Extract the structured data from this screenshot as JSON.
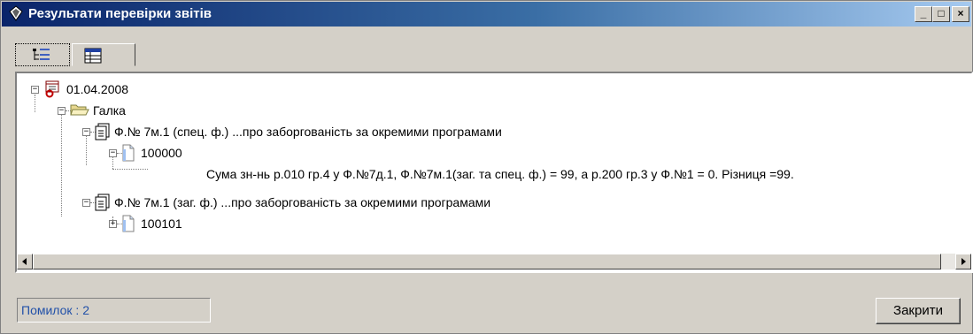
{
  "window": {
    "title": "Результати перевірки звітів",
    "controls": {
      "minimize": "_",
      "maximize": "□",
      "close": "×"
    }
  },
  "tabs": [
    {
      "name": "tree-view",
      "icon": "tree-list-icon"
    },
    {
      "name": "table-view",
      "icon": "table-grid-icon"
    }
  ],
  "tree": {
    "nodes": [
      {
        "label": "01.04.2008",
        "icon": "calendar-error-icon",
        "expanded": true
      },
      {
        "label": "Галка",
        "icon": "folder-open-icon",
        "expanded": true
      },
      {
        "label": "Ф.№ 7м.1 (спец. ф.) ...про заборгованість за окремими програмами",
        "icon": "document-icon",
        "expanded": true
      },
      {
        "label": "100000",
        "icon": "page-icon",
        "expanded": true
      },
      {
        "label": "Сума зн-нь р.010 гр.4 у Ф.№7д.1, Ф.№7м.1(заг. та спец. ф.) =   99,    а р.200 гр.3 у Ф.№1 =   0.   Різниця =99.",
        "icon": ""
      },
      {
        "label": "Ф.№ 7м.1 (заг. ф.) ...про заборгованість за окремими програмами",
        "icon": "document-icon",
        "expanded": true
      },
      {
        "label": "100101",
        "icon": "page-icon",
        "expanded": false
      }
    ]
  },
  "status": {
    "errors_label": "Помилок :",
    "errors_value": "2"
  },
  "buttons": {
    "close_label": "Закрити"
  }
}
